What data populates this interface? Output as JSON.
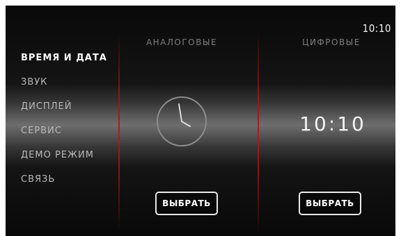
{
  "status": {
    "time": "10:10"
  },
  "menu": {
    "items": [
      {
        "label": "ВРЕМЯ И ДАТА",
        "active": true
      },
      {
        "label": "ЗВУК",
        "active": false
      },
      {
        "label": "ДИСПЛЕЙ",
        "active": false
      },
      {
        "label": "СЕРВИС",
        "active": false
      },
      {
        "label": "ДЕМО РЕЖИМ",
        "active": false
      },
      {
        "label": "СВЯЗЬ",
        "active": false
      }
    ]
  },
  "panels": {
    "analog": {
      "title": "АНАЛОГОВЫЕ",
      "select_label": "ВЫБРАТЬ",
      "clock_icon": "analog-clock-icon"
    },
    "digital": {
      "title": "ЦИФРОВЫЕ",
      "time": "10:10",
      "select_label": "ВЫБРАТЬ"
    }
  },
  "colors": {
    "divider_accent": "#aa1e1e",
    "background": "#111111",
    "text": "#e6e6e6"
  }
}
